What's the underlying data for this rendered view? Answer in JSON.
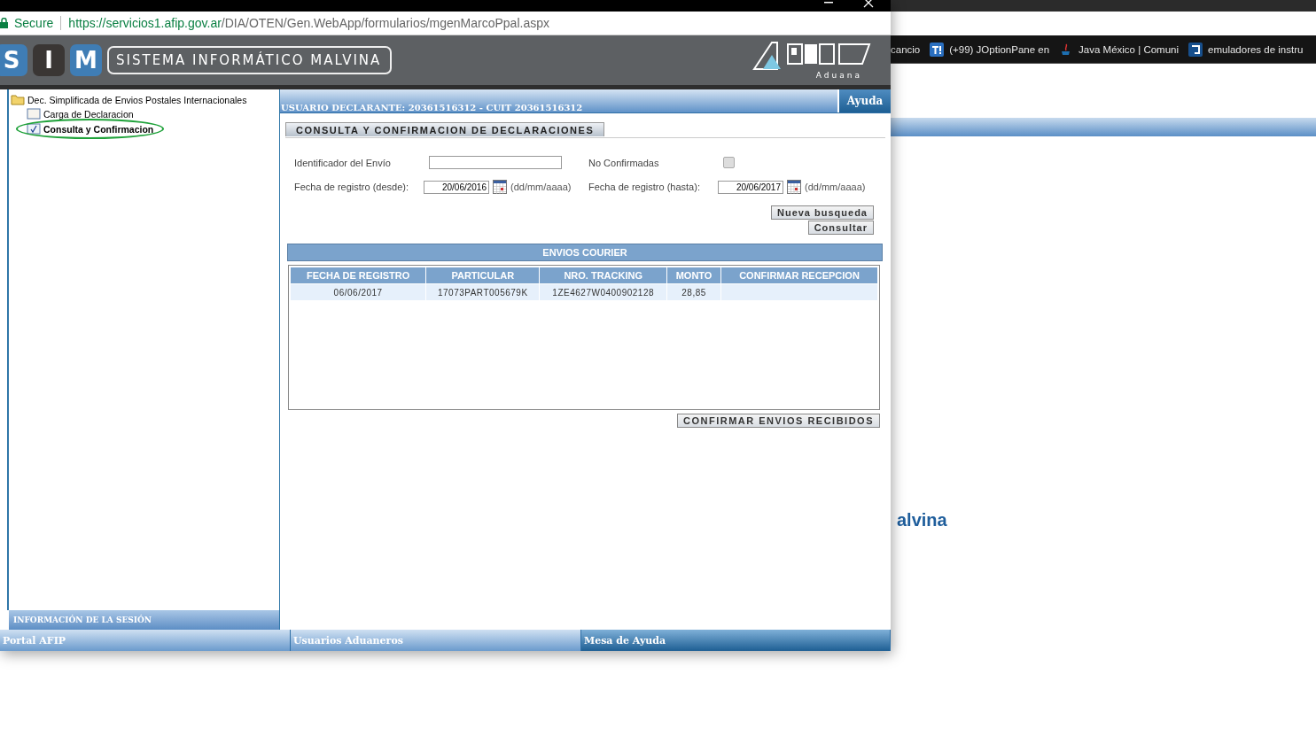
{
  "background": {
    "bookmarks": [
      {
        "label": "cancio",
        "kind": "none"
      },
      {
        "label": "(+99) JOptionPane en",
        "kind": "t"
      },
      {
        "label": "Java México | Comuni",
        "kind": "java"
      },
      {
        "label": "emuladores de instru",
        "kind": "d"
      }
    ],
    "heading": "alvina"
  },
  "window": {
    "address": {
      "security": "Secure",
      "host": "https://servicios1.afip.gov.ar",
      "path": "/DIA/OTEN/Gen.WebApp/formularios/mgenMarcoPpal.aspx"
    }
  },
  "header": {
    "logo_letters": [
      "S",
      "I",
      "M"
    ],
    "system_name": "SISTEMA INFORMÁTICO MALVINA",
    "agency": "Aduana"
  },
  "tree": [
    {
      "label": "Dec. Simplificada de Envios Postales Internacionales",
      "kind": "folder",
      "children": [
        {
          "label": "Carga de Declaracion",
          "kind": "page",
          "selected": false
        },
        {
          "label": "Consulta y Confirmacion",
          "kind": "page",
          "selected": true
        }
      ]
    }
  ],
  "session_panel": {
    "title": "INFORMACIÓN DE LA SESIÓN"
  },
  "user_bar": {
    "text": "USUARIO DECLARANTE: 20361516312 - CUIT 20361516312",
    "help": "Ayuda"
  },
  "form": {
    "title": "CONSULTA Y CONFIRMACION DE DECLARACIONES",
    "shipment_id": {
      "label": "Identificador del Envío"
    },
    "unconfirmed": {
      "label": "No Confirmadas",
      "checked": false
    },
    "date_from": {
      "label": "Fecha de registro (desde):",
      "value": "20/06/2016",
      "hint": "(dd/mm/aaaa)"
    },
    "date_to": {
      "label": "Fecha de registro (hasta):",
      "value": "20/06/2017",
      "hint": "(dd/mm/aaaa)"
    },
    "buttons": [
      "Nueva busqueda",
      "Consultar"
    ]
  },
  "table": {
    "title": "ENVIOS COURIER",
    "columns": [
      "FECHA DE REGISTRO",
      "PARTICULAR",
      "NRO. TRACKING",
      "MONTO",
      "CONFIRMAR RECEPCION"
    ],
    "rows": [
      {
        "cells": [
          "06/06/2017",
          "17073PART005679K",
          "1ZE4627W0400902128",
          "28,85"
        ]
      }
    ]
  },
  "confirm_button": "CONFIRMAR ENVIOS RECIBIDOS",
  "footer": [
    "Portal AFIP",
    "Usuarios Aduaneros",
    "Mesa de Ayuda"
  ]
}
